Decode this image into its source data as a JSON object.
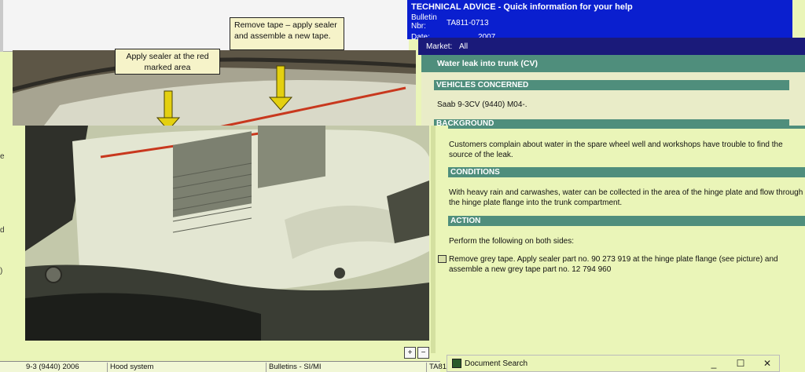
{
  "picture": {
    "callout_1": "Apply sealer at the red marked area",
    "callout_2": "Remove tape – apply sealer and assemble a new tape."
  },
  "left_margin": [
    "e",
    "d",
    ")"
  ],
  "status_bar": {
    "model": "9-3 (9440) 2006",
    "group": "Hood system",
    "source": "Bulletins - SI/MI",
    "doc": "TA81"
  },
  "header": {
    "title": "TECHNICAL ADVICE - Quick information for your help",
    "bulletin_label": "Bulletin Nbr:",
    "bulletin_nbr": "TA811-0713",
    "date_label": "Date:",
    "date_value": "2007",
    "market_label": "Market:",
    "market_value": "All"
  },
  "document": {
    "title": "Water leak into trunk (CV)",
    "vehicles_heading": "VEHICLES CONCERNED",
    "vehicles_text": "Saab 9-3CV (9440) M04-.",
    "background_heading": "BACKGROUND",
    "background_text": "Customers complain about water in the spare wheel well and workshops have trouble to find the source of the leak.",
    "conditions_heading": "CONDITIONS",
    "conditions_text": "With heavy rain and carwashes, water can be collected in the area of the hinge plate and flow through the hinge plate flange into the trunk compartment.",
    "action_heading": "ACTION",
    "action_intro": "Perform the following on both sides:",
    "action_step": "Remove grey tape. Apply sealer part no. 90 273 919 at the hinge plate flange (see picture) and assemble a new grey tape part no. 12 794 960"
  },
  "document_search": {
    "title": "Document Search",
    "minimize": "_",
    "maximize": "☐",
    "close": "✕"
  },
  "zoom": {
    "zoom_in": "+",
    "zoom_out": "−"
  },
  "colors": {
    "header_blue": "#0a1fcf",
    "section_green": "#4f8e7c",
    "background": "#eaf5b8",
    "sealer_red": "#c8381e",
    "arrow_yellow": "#e4d010"
  }
}
